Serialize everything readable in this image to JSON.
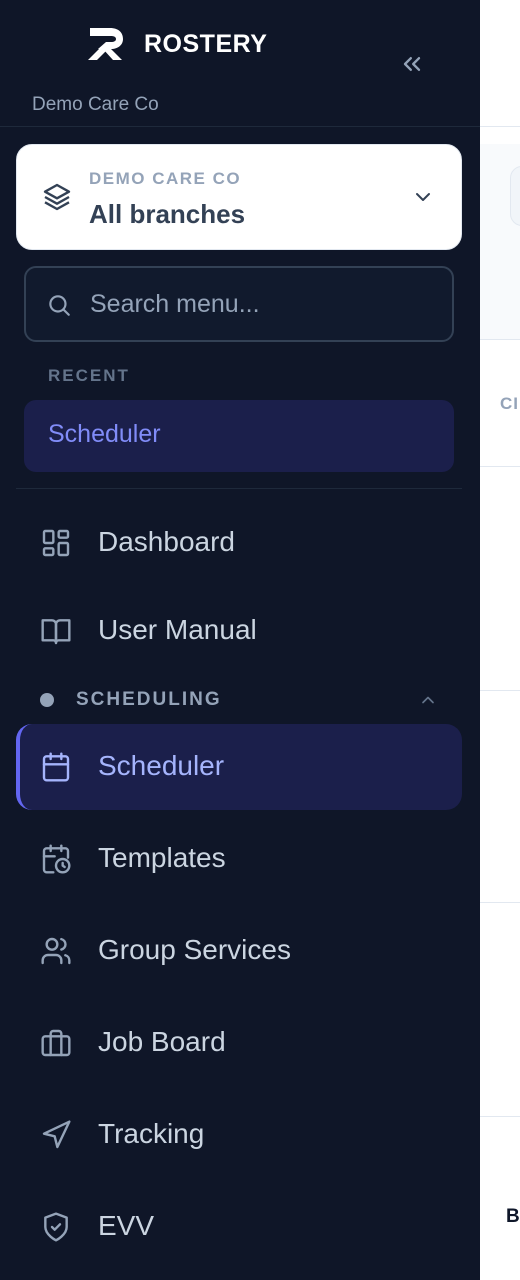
{
  "brand": {
    "name": "ROSTERY",
    "org_subtitle": "Demo Care Co"
  },
  "branch_selector": {
    "org_label": "DEMO CARE CO",
    "value": "All branches"
  },
  "search": {
    "placeholder": "Search menu..."
  },
  "recent": {
    "label": "RECENT",
    "items": [
      {
        "label": "Scheduler"
      }
    ]
  },
  "nav": {
    "top_items": [
      {
        "label": "Dashboard",
        "icon": "dashboard-icon"
      },
      {
        "label": "User Manual",
        "icon": "book-icon"
      }
    ],
    "scheduling": {
      "label": "SCHEDULING",
      "items": [
        {
          "label": "Scheduler",
          "icon": "calendar-icon",
          "active": true
        },
        {
          "label": "Templates",
          "icon": "calendar-clock-icon"
        },
        {
          "label": "Group Services",
          "icon": "users-icon"
        },
        {
          "label": "Job Board",
          "icon": "briefcase-icon"
        },
        {
          "label": "Tracking",
          "icon": "navigation-icon"
        },
        {
          "label": "EVV",
          "icon": "shield-check-icon"
        }
      ]
    }
  },
  "content": {
    "column_header_fragment": "CI",
    "cell_fragment": "B"
  },
  "colors": {
    "sidebar_bg": "#0f1628",
    "accent": "#6366f1",
    "active_bg": "#1b1f4b"
  }
}
